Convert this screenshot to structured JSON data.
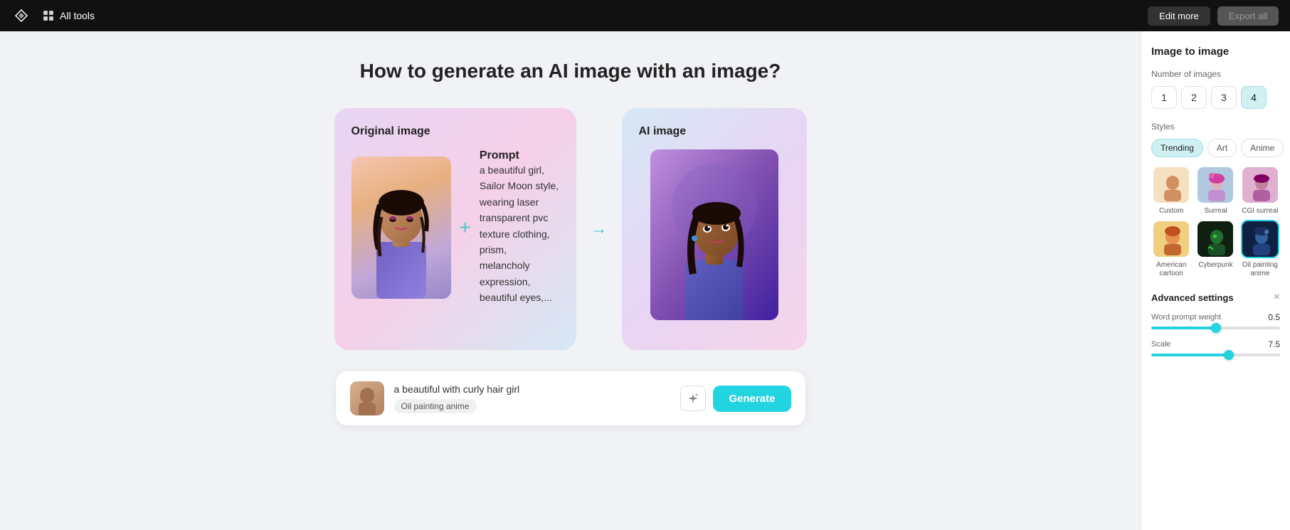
{
  "topnav": {
    "brand_label": "All tools",
    "edit_more": "Edit more",
    "export_all": "Export all"
  },
  "page": {
    "title": "How to generate an AI image with an image?"
  },
  "image_flow": {
    "original_label": "Original image",
    "prompt_label": "Prompt",
    "ai_label": "AI image",
    "prompt_text": "a beautiful girl, Sailor Moon style, wearing laser transparent pvc texture clothing, prism, melancholy expression, beautiful eyes,...",
    "arrow": "→",
    "plus": "+"
  },
  "bottom_bar": {
    "prompt": "a beautiful with curly hair girl",
    "tag": "Oil painting anime",
    "generate": "Generate"
  },
  "right_panel": {
    "title": "Image to image",
    "num_images_label": "Number of images",
    "numbers": [
      "1",
      "2",
      "3",
      "4"
    ],
    "active_number": 3,
    "styles_label": "Styles",
    "style_tabs": [
      "Trending",
      "Art",
      "Anime"
    ],
    "active_tab": 0,
    "styles": [
      {
        "label": "Custom",
        "key": "custom"
      },
      {
        "label": "Surreal",
        "key": "surreal"
      },
      {
        "label": "CGI surreal",
        "key": "cgi"
      },
      {
        "label": "American cartoon",
        "key": "american"
      },
      {
        "label": "Cyberpunk",
        "key": "cyberpunk"
      },
      {
        "label": "Oil painting anime",
        "key": "oil",
        "selected": true
      }
    ],
    "advanced_title": "Advanced settings",
    "word_prompt_weight_label": "Word prompt weight",
    "word_prompt_weight_value": "0.5",
    "word_prompt_weight_pct": 50,
    "scale_label": "Scale",
    "scale_value": "7.5",
    "scale_pct": 60
  }
}
